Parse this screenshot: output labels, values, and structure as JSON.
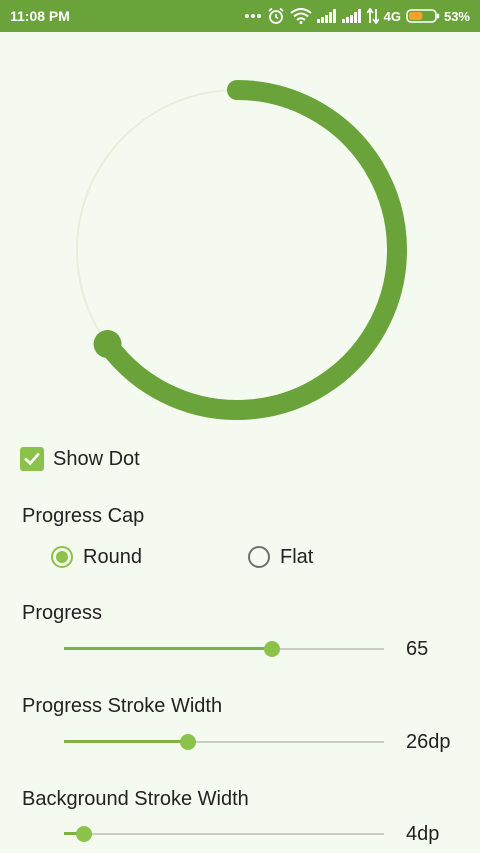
{
  "status_bar": {
    "time": "11:08 PM",
    "network": "4G",
    "battery_percent": "53%",
    "battery_level": 0.53,
    "icons": [
      "more-dots-icon",
      "alarm-icon",
      "wifi-icon",
      "signal-icon",
      "signal-icon",
      "data-transfer-icon",
      "battery-icon"
    ]
  },
  "progress_circle": {
    "progress": 65,
    "show_dot": true,
    "cap": "Round",
    "progress_color": "#6aa339",
    "background_color": "#e6efdc"
  },
  "show_dot": {
    "label": "Show Dot",
    "checked": true
  },
  "progress_cap": {
    "title": "Progress Cap",
    "options": [
      {
        "label": "Round",
        "selected": true
      },
      {
        "label": "Flat",
        "selected": false
      }
    ]
  },
  "sliders": [
    {
      "label": "Progress",
      "value_text": "65",
      "level": 0.65
    },
    {
      "label": "Progress Stroke Width",
      "value_text": "26dp",
      "level": 0.387
    },
    {
      "label": "Background Stroke Width",
      "value_text": "4dp",
      "level": 0.0625
    }
  ],
  "colors": {
    "accent": "#8bc34a",
    "status_bar": "#6aa339",
    "background": "#f4faf0"
  }
}
